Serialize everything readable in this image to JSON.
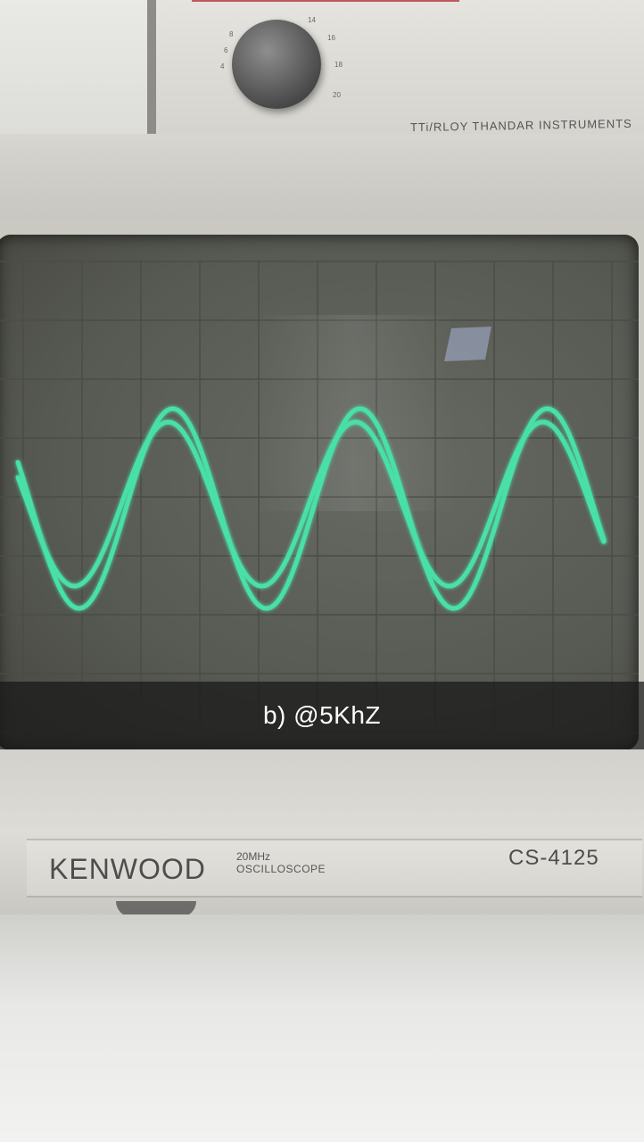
{
  "caption": "b) @5KhZ",
  "scope": {
    "brand": "KENWOOD",
    "spec_line1": "20MHz",
    "spec_line2": "OSCILLOSCOPE",
    "model": "CS-4125"
  },
  "generator": {
    "brand": "TTi/RLOY THANDAR INSTRUMENTS",
    "dial_ticks": [
      "4",
      "6",
      "8",
      "14",
      "16",
      "18",
      "20"
    ]
  },
  "colors": {
    "trace": "#48e0a8",
    "screen": "#5f615b",
    "grid": "#4a4c47",
    "caption_bar": "#181818"
  }
}
